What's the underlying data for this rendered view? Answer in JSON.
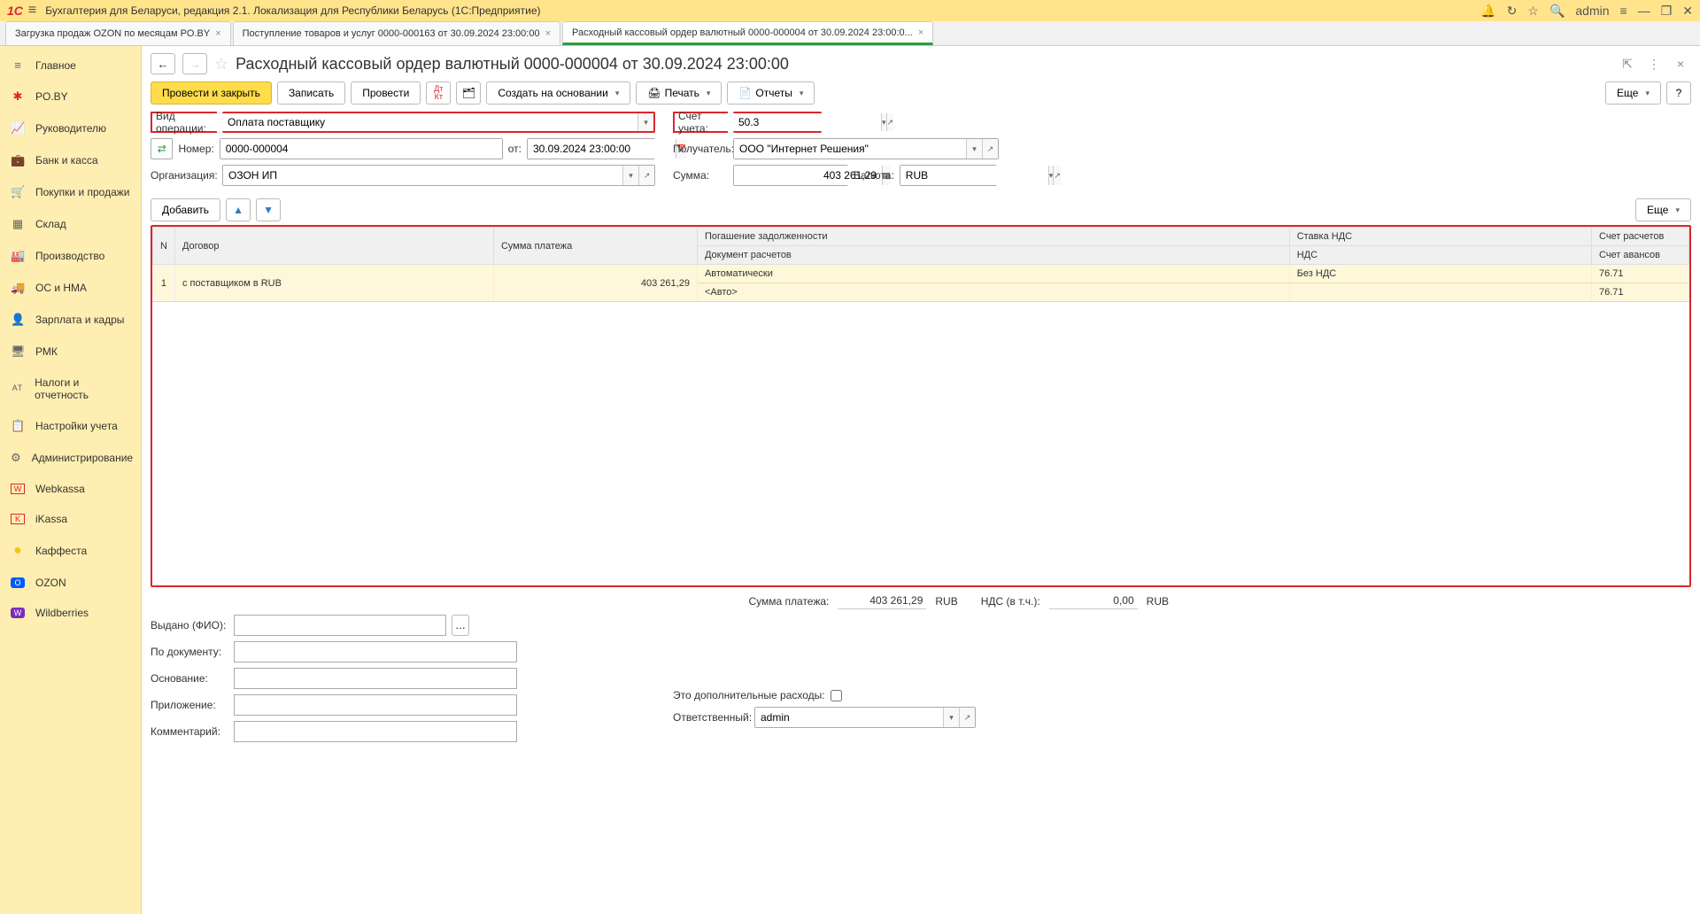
{
  "titlebar": {
    "logo": "1C",
    "title": "Бухгалтерия для Беларуси, редакция 2.1. Локализация для Республики Беларусь   (1С:Предприятие)",
    "user": "admin"
  },
  "tabs": [
    {
      "label": "Загрузка продаж OZON по месяцам PO.BY",
      "active": false
    },
    {
      "label": "Поступление товаров и услуг 0000-000163 от 30.09.2024 23:00:00",
      "active": false
    },
    {
      "label": "Расходный кассовый ордер валютный 0000-000004 от 30.09.2024 23:00:0...",
      "active": true
    }
  ],
  "sidebar": [
    {
      "icon": "≡",
      "label": "Главное"
    },
    {
      "icon": "✱",
      "label": "PO.BY"
    },
    {
      "icon": "📈",
      "label": "Руководителю"
    },
    {
      "icon": "💼",
      "label": "Банк и касса"
    },
    {
      "icon": "🛒",
      "label": "Покупки и продажи"
    },
    {
      "icon": "▦",
      "label": "Склад"
    },
    {
      "icon": "🏭",
      "label": "Производство"
    },
    {
      "icon": "🚚",
      "label": "ОС и НМА"
    },
    {
      "icon": "👤",
      "label": "Зарплата и кадры"
    },
    {
      "icon": "🖥",
      "label": "РМК"
    },
    {
      "icon": "ᴬᵀ",
      "label": "Налоги и отчетность"
    },
    {
      "icon": "📋",
      "label": "Настройки учета"
    },
    {
      "icon": "⚙",
      "label": "Администрирование"
    },
    {
      "icon": "W",
      "label": "Webkassa"
    },
    {
      "icon": "K",
      "label": "iKassa"
    },
    {
      "icon": "●",
      "label": "Каффеста"
    },
    {
      "icon": "O",
      "label": "OZON"
    },
    {
      "icon": "W",
      "label": "Wildberries"
    }
  ],
  "header": {
    "title": "Расходный кассовый ордер валютный 0000-000004 от 30.09.2024 23:00:00"
  },
  "toolbar": {
    "post_close": "Провести и закрыть",
    "write": "Записать",
    "post": "Провести",
    "create_based": "Создать на основании",
    "print": "Печать",
    "reports": "Отчеты",
    "more": "Еще"
  },
  "form": {
    "op_type_label": "Вид операции:",
    "op_type": "Оплата поставщику",
    "account_label": "Счет учета:",
    "account": "50.3",
    "number_label": "Номер:",
    "number": "0000-000004",
    "date_label": "от:",
    "date": "30.09.2024 23:00:00",
    "recipient_label": "Получатель:",
    "recipient": "ООО \"Интернет Решения\"",
    "org_label": "Организация:",
    "org": "ОЗОН ИП",
    "sum_label": "Сумма:",
    "sum": "403 261,29",
    "currency_label": "Валюта:",
    "currency": "RUB",
    "add": "Добавить"
  },
  "table": {
    "headers": {
      "n": "N",
      "contract": "Договор",
      "payment_sum": "Сумма платежа",
      "debt_repay": "Погашение задолженности",
      "doc_settle": "Документ расчетов",
      "vat_rate": "Ставка НДС",
      "vat": "НДС",
      "settle_acc": "Счет расчетов",
      "advance_acc": "Счет авансов"
    },
    "row": {
      "n": "1",
      "contract": "с поставщиком в RUB",
      "sum": "403 261,29",
      "repay": "Автоматически",
      "doc": "<Авто>",
      "vat_rate": "Без НДС",
      "vat": "",
      "settle": "76.71",
      "advance": "76.71"
    },
    "more": "Еще"
  },
  "summary": {
    "sum_label": "Сумма платежа:",
    "sum_val": "403 261,29",
    "sum_cur": "RUB",
    "vat_label": "НДС (в т.ч.):",
    "vat_val": "0,00",
    "vat_cur": "RUB"
  },
  "bottom": {
    "issued_label": "Выдано (ФИО):",
    "by_doc_label": "По документу:",
    "basis_label": "Основание:",
    "attachment_label": "Приложение:",
    "extra_costs_label": "Это дополнительные расходы:",
    "comment_label": "Комментарий:",
    "responsible_label": "Ответственный:",
    "responsible": "admin"
  }
}
